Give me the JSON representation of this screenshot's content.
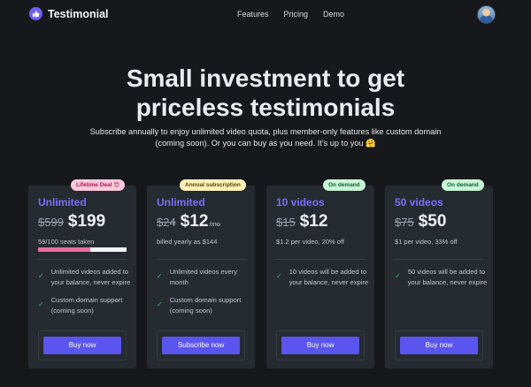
{
  "nav": {
    "brand": "Testimonial",
    "links": [
      "Features",
      "Pricing",
      "Demo"
    ]
  },
  "hero": {
    "title_line1": "Small investment to get",
    "title_line2": "priceless testimonials",
    "subtitle": "Subscribe annually to enjoy unlimited video quota, plus member-only features like custom domain (coming soon). Or you can buy as you need. It's up to you 🤗"
  },
  "cards": [
    {
      "badge": "Lifetime Deal 😍",
      "name": "Unlimited",
      "old_price": "$599",
      "price": "$199",
      "per": "",
      "note": "59/100 seats taken",
      "progress": 0.59,
      "features": [
        "Unlimited videos added to your balance, never expire",
        "Custom domain support (coming soon)"
      ],
      "button": "Buy now"
    },
    {
      "badge": "Annual subscription",
      "name": "Unlimited",
      "old_price": "$24",
      "price": "$12",
      "per": "/mo",
      "note": "billed yearly as $144",
      "features": [
        "Unlimited videos every month",
        "Custom domain support (coming soon)"
      ],
      "button": "Subscribe now"
    },
    {
      "badge": "On demand",
      "name": "10 videos",
      "old_price": "$15",
      "price": "$12",
      "per": "",
      "note": "$1.2 per video, 20% off",
      "features": [
        "10 videos will be added to your balance, never expire"
      ],
      "button": "Buy now"
    },
    {
      "badge": "On demand",
      "name": "50 videos",
      "old_price": "$75",
      "price": "$50",
      "per": "",
      "note": "$1 per video, 33% off",
      "features": [
        "50 videos will be added to your balance, never expire"
      ],
      "button": "Buy now"
    }
  ],
  "colors": {
    "accent": "#5a55ee",
    "plan_name": "#7b6ffa",
    "check": "#35c46a",
    "progress_fill": "#ec6aa0"
  }
}
